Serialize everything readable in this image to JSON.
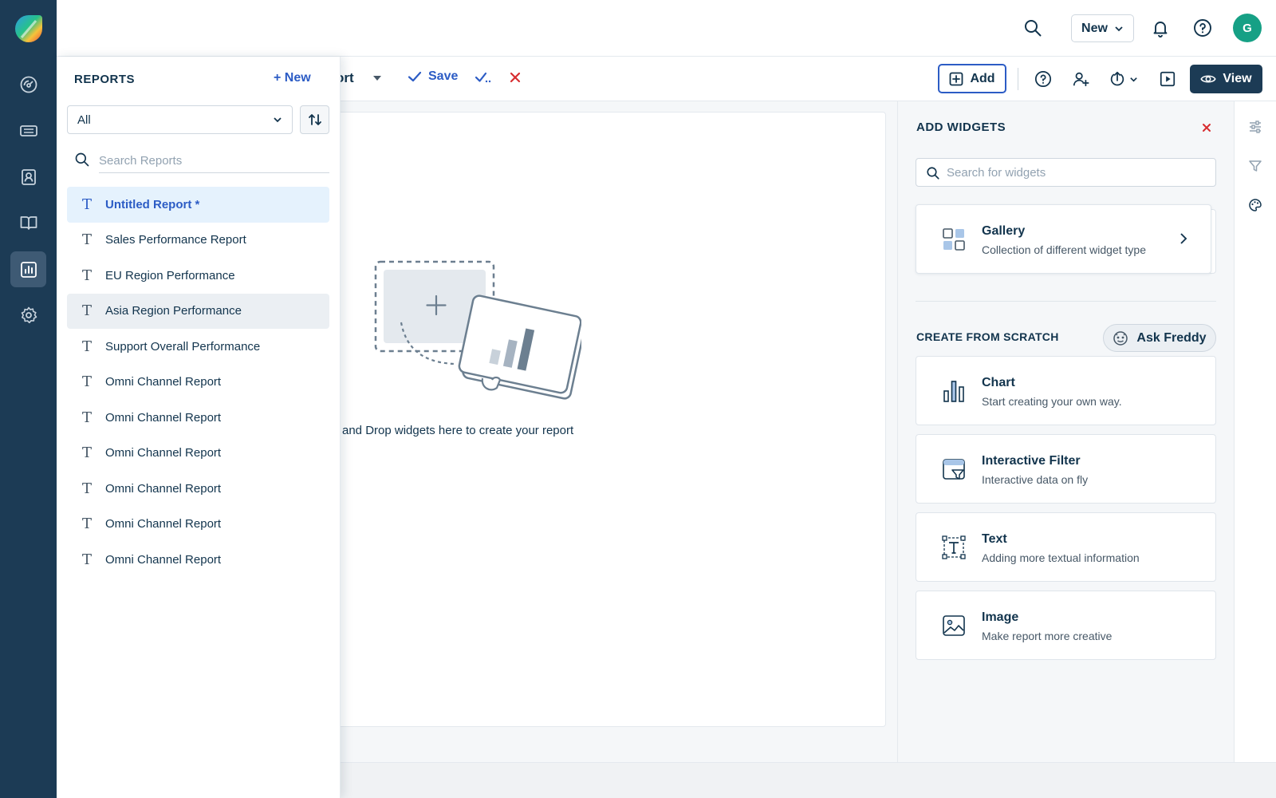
{
  "topbar": {
    "new_label": "New",
    "avatar_initial": "G"
  },
  "nav": {
    "items": [
      "dashboard-icon",
      "tickets-icon",
      "contacts-icon",
      "knowledge-base-icon",
      "analytics-icon",
      "settings-icon"
    ],
    "active": "analytics-icon"
  },
  "toolbar": {
    "title_fragment": "ort",
    "save_label": "Save",
    "add_label": "Add",
    "view_label": "View"
  },
  "canvas": {
    "drop_text": "and Drop widgets here to create your report"
  },
  "reports": {
    "heading": "REPORTS",
    "new_label": "+ New",
    "filter_value": "All",
    "search_placeholder": "Search Reports",
    "items": [
      {
        "label": "Untitled Report *",
        "state": "active"
      },
      {
        "label": "Sales Performance Report",
        "state": ""
      },
      {
        "label": "EU Region Performance",
        "state": ""
      },
      {
        "label": "Asia Region Performance",
        "state": "hover"
      },
      {
        "label": "Support Overall Performance",
        "state": ""
      },
      {
        "label": "Omni Channel Report",
        "state": ""
      },
      {
        "label": "Omni Channel Report",
        "state": ""
      },
      {
        "label": "Omni Channel Report",
        "state": ""
      },
      {
        "label": "Omni Channel Report",
        "state": ""
      },
      {
        "label": "Omni Channel Report",
        "state": ""
      },
      {
        "label": "Omni Channel Report",
        "state": ""
      }
    ]
  },
  "widgets": {
    "heading": "ADD WIDGETS",
    "search_placeholder": "Search for widgets",
    "gallery": {
      "title": "Gallery",
      "subtitle": "Collection of different widget type"
    },
    "scratch_heading": "CREATE FROM SCRATCH",
    "freddy_label": "Ask Freddy",
    "cards": [
      {
        "icon": "chart-icon",
        "title": "Chart",
        "subtitle": "Start creating your own way."
      },
      {
        "icon": "interactive-filter-icon",
        "title": "Interactive Filter",
        "subtitle": "Interactive data on fly"
      },
      {
        "icon": "text-widget-icon",
        "title": "Text",
        "subtitle": "Adding more textual information"
      },
      {
        "icon": "image-icon",
        "title": "Image",
        "subtitle": "Make report more creative"
      }
    ]
  },
  "colors": {
    "rail": "#1c3b55",
    "accent": "#2c5cc5",
    "danger": "#d72d30",
    "active_item_bg": "#e5f2fd"
  }
}
